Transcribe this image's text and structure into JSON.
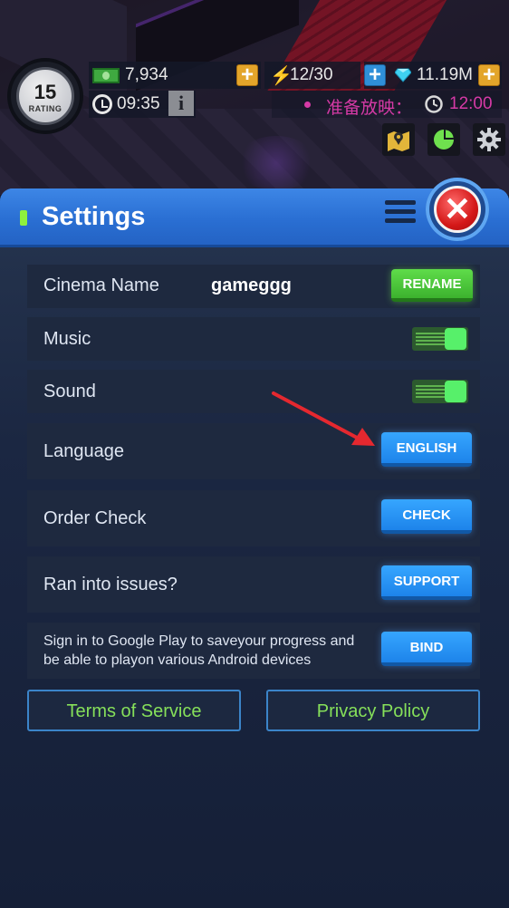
{
  "hud": {
    "rating_value": "15",
    "rating_label": "RATING",
    "money": "7,934",
    "energy": "12/30",
    "gems": "11.19M",
    "timer": "09:35",
    "show_label": "准备放映：",
    "show_time": "12:00",
    "icons": [
      "cash-icon",
      "bolt-icon",
      "diamond-icon",
      "clock-icon",
      "info-icon",
      "map-icon",
      "pie-chart-icon",
      "gear-icon"
    ]
  },
  "settings": {
    "title": "Settings",
    "cinema_name_label": "Cinema Name",
    "cinema_name_value": "gameggg",
    "rename_label": "RENAME",
    "music_label": "Music",
    "music_on": true,
    "sound_label": "Sound",
    "sound_on": true,
    "language_label": "Language",
    "language_button": "ENGLISH",
    "order_check_label": "Order Check",
    "check_button": "CHECK",
    "issues_label": "Ran into issues?",
    "support_button": "SUPPORT",
    "signin_text_line1": "Sign in to Google Play to saveyour progress and",
    "signin_text_line2": "be able to playon various Android devices",
    "bind_button": "BIND",
    "terms_label": "Terms of Service",
    "privacy_label": "Privacy Policy"
  },
  "colors": {
    "header_blue": "#2a6fd3",
    "button_blue": "#1d84ea",
    "button_green": "#3cb22e",
    "link_green": "#86e05a",
    "show_pink": "#d63aa6",
    "annotation_red": "#e5282f"
  }
}
